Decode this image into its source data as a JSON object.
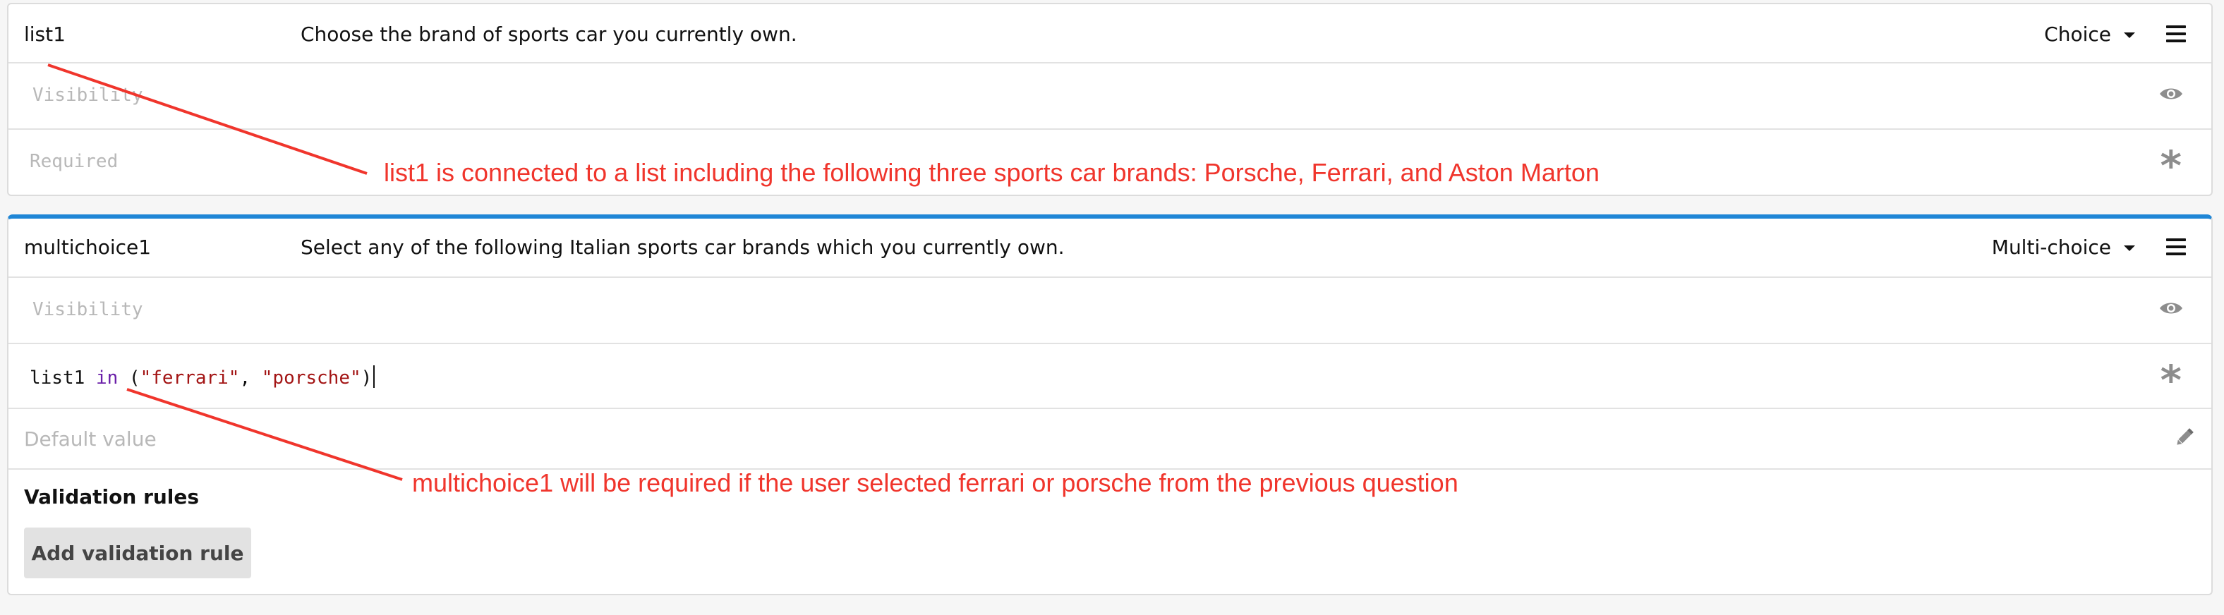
{
  "questions": [
    {
      "name": "list1",
      "text": "Choose the brand of sports car you currently own.",
      "type": "Choice",
      "visibility_placeholder": "Visibility",
      "required_placeholder": "Required"
    },
    {
      "name": "multichoice1",
      "text": "Select any of the following Italian sports car brands which you currently own.",
      "type": "Multi-choice",
      "visibility_placeholder": "Visibility",
      "required_expression": {
        "var": "list1",
        "op": "in",
        "open": "(",
        "str1": "\"ferrari\"",
        "sep": ", ",
        "str2": "\"porsche\"",
        "close": ")"
      },
      "default_placeholder": "Default value",
      "validation_label": "Validation rules",
      "add_rule_label": "Add validation rule"
    }
  ],
  "annotations": [
    "list1 is connected to a list including the following three sports car brands: Porsche, Ferrari, and Aston Marton",
    "multichoice1 will be required if the user selected ferrari or porsche from the previous question"
  ],
  "colors": {
    "annotation": "#f0352c",
    "accent": "#1f86d6",
    "keyword": "#6a1fa8",
    "string": "#a31515"
  },
  "icons": [
    "chevron-down-icon",
    "menu-icon",
    "eye-icon",
    "asterisk-icon",
    "pencil-icon"
  ]
}
